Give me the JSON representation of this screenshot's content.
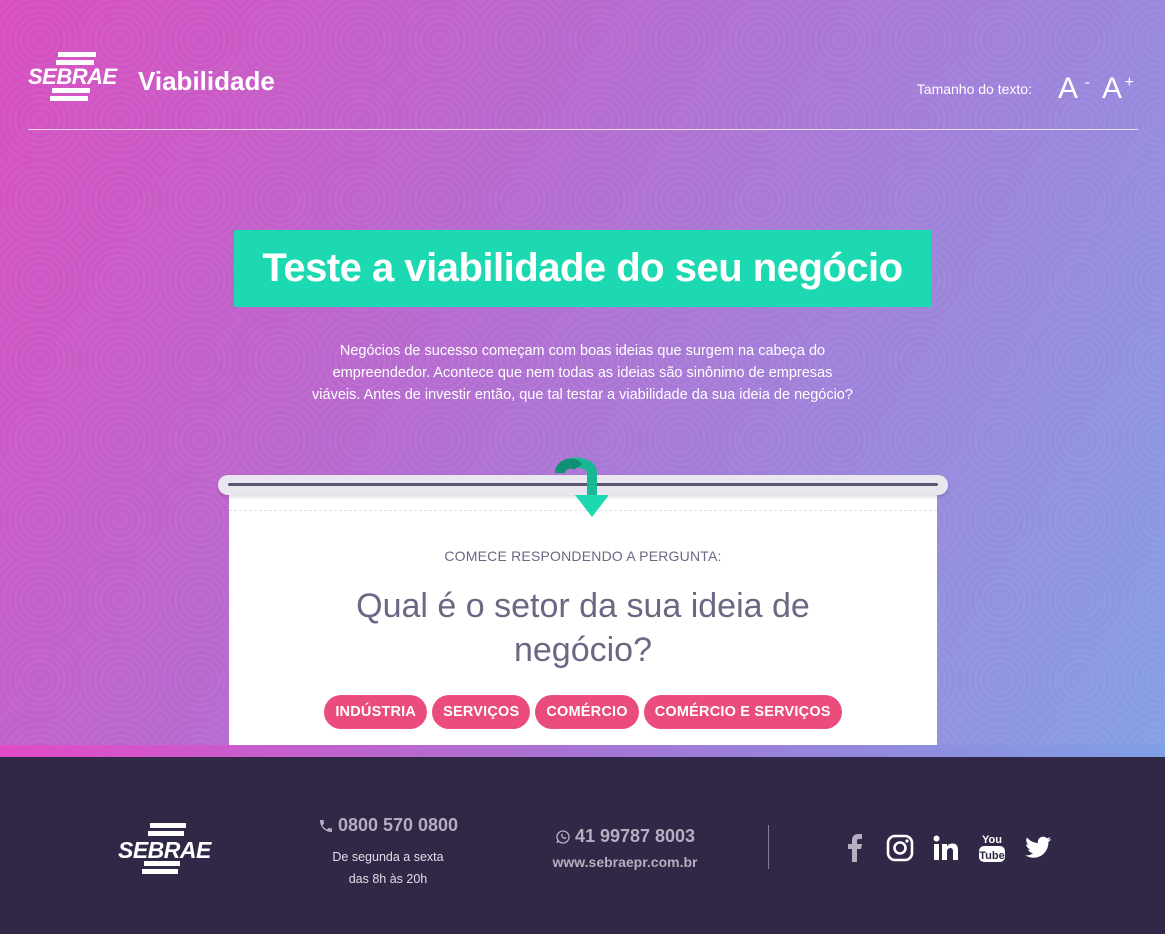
{
  "header": {
    "logo_text": "SEBRAE",
    "app_name": "Viabilidade",
    "text_size_label": "Tamanho do texto:",
    "decrease_label": "A",
    "decrease_sup": "-",
    "increase_label": "A",
    "increase_sup": "+"
  },
  "hero": {
    "headline": "Teste a viabilidade do seu negócio",
    "intro": "Negócios de sucesso começam com boas ideias que surgem na cabeça do empreendedor. Acontece que nem todas as ideias são sinônimo de empresas viáveis. Antes de investir então, que tal testar a viabilidade da sua ideia de negócio?"
  },
  "card": {
    "prompt": "COMECE RESPONDENDO A PERGUNTA:",
    "question": "Qual é o setor da sua ideia de negócio?",
    "options": [
      "INDÚSTRIA",
      "SERVIÇOS",
      "COMÉRCIO",
      "COMÉRCIO E SERVIÇOS"
    ]
  },
  "footer": {
    "logo_text": "SEBRAE",
    "phone": "0800 570 0800",
    "hours_line1": "De segunda a sexta",
    "hours_line2": "das 8h às 20h",
    "whatsapp": "41 99787 8003",
    "website": "www.sebraepr.com.br",
    "social_icons": [
      "facebook-icon",
      "instagram-icon",
      "linkedin-icon",
      "youtube-icon",
      "twitter-icon"
    ]
  },
  "colors": {
    "accent_green": "#1dd9b2",
    "chip_pink": "#ea4c7c",
    "footer_bg": "#302846",
    "question_text": "#6e6683"
  }
}
